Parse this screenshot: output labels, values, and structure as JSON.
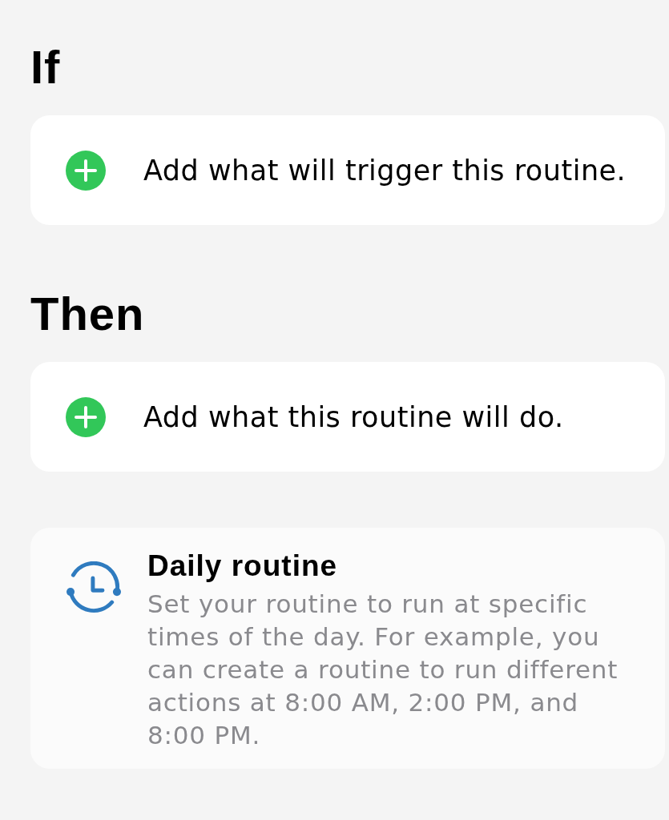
{
  "sections": [
    {
      "heading": "If",
      "action": {
        "label": "Add what will trigger this routine."
      }
    },
    {
      "heading": "Then",
      "action": {
        "label": "Add what this routine will do."
      }
    }
  ],
  "suggestion": {
    "title": "Daily routine",
    "description": "Set your routine to run at specific times of the day. For example, you can create a routine to run different actions at 8:00 AM, 2:00 PM, and 8:00 PM."
  }
}
